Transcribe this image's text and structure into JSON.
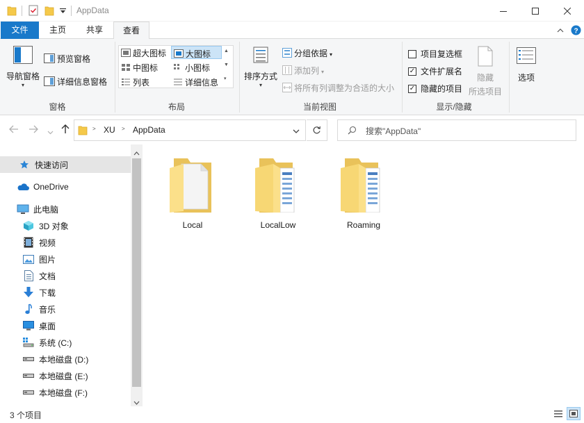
{
  "titlebar": {
    "title": "AppData",
    "minimize_icon": "minimize-icon",
    "maximize_icon": "maximize-icon",
    "close_icon": "close-icon"
  },
  "tabs": [
    {
      "label": "文件"
    },
    {
      "label": "主页"
    },
    {
      "label": "共享"
    },
    {
      "label": "查看"
    }
  ],
  "ribbon": {
    "pane": {
      "nav_pane": "导航窗格",
      "preview_pane": "预览窗格",
      "details_pane": "详细信息窗格",
      "group": "窗格"
    },
    "layout": {
      "extra_large": "超大图标",
      "large": "大图标",
      "medium": "中图标",
      "small": "小图标",
      "list": "列表",
      "details": "详细信息",
      "group": "布局"
    },
    "current_view": {
      "sort_by": "排序方式",
      "group_by": "分组依据",
      "add_column": "添加列",
      "fit_columns": "将所有列调整为合适的大小",
      "group": "当前视图"
    },
    "show_hide": {
      "item_checkboxes": "项目复选框",
      "item_checkboxes_checked": false,
      "file_extensions": "文件扩展名",
      "file_extensions_checked": true,
      "hidden_items": "隐藏的项目",
      "hidden_items_checked": true,
      "hide_selected_1": "隐藏",
      "hide_selected_2": "所选项目",
      "group": "显示/隐藏"
    },
    "options": "选项"
  },
  "address": {
    "path": [
      "XU",
      "AppData"
    ],
    "search_placeholder": "搜索\"AppData\""
  },
  "sidebar": {
    "items": [
      {
        "label": "快速访问",
        "icon": "star-icon"
      },
      {
        "label": "OneDrive",
        "icon": "cloud-icon"
      },
      {
        "label": "此电脑",
        "icon": "computer-icon"
      },
      {
        "label": "3D 对象",
        "icon": "cube-icon"
      },
      {
        "label": "视频",
        "icon": "video-icon"
      },
      {
        "label": "图片",
        "icon": "picture-icon"
      },
      {
        "label": "文档",
        "icon": "document-icon"
      },
      {
        "label": "下载",
        "icon": "download-icon"
      },
      {
        "label": "音乐",
        "icon": "music-icon"
      },
      {
        "label": "桌面",
        "icon": "desktop-icon"
      },
      {
        "label": "系统 (C:)",
        "icon": "system-drive-icon"
      },
      {
        "label": "本地磁盘 (D:)",
        "icon": "drive-icon"
      },
      {
        "label": "本地磁盘 (E:)",
        "icon": "drive-icon"
      },
      {
        "label": "本地磁盘 (F:)",
        "icon": "drive-icon"
      }
    ]
  },
  "folders": [
    {
      "name": "Local"
    },
    {
      "name": "LocalLow"
    },
    {
      "name": "Roaming"
    }
  ],
  "status": {
    "count": "3 个项目"
  },
  "colors": {
    "accent": "#1979ca",
    "folder": "#f7d774"
  }
}
